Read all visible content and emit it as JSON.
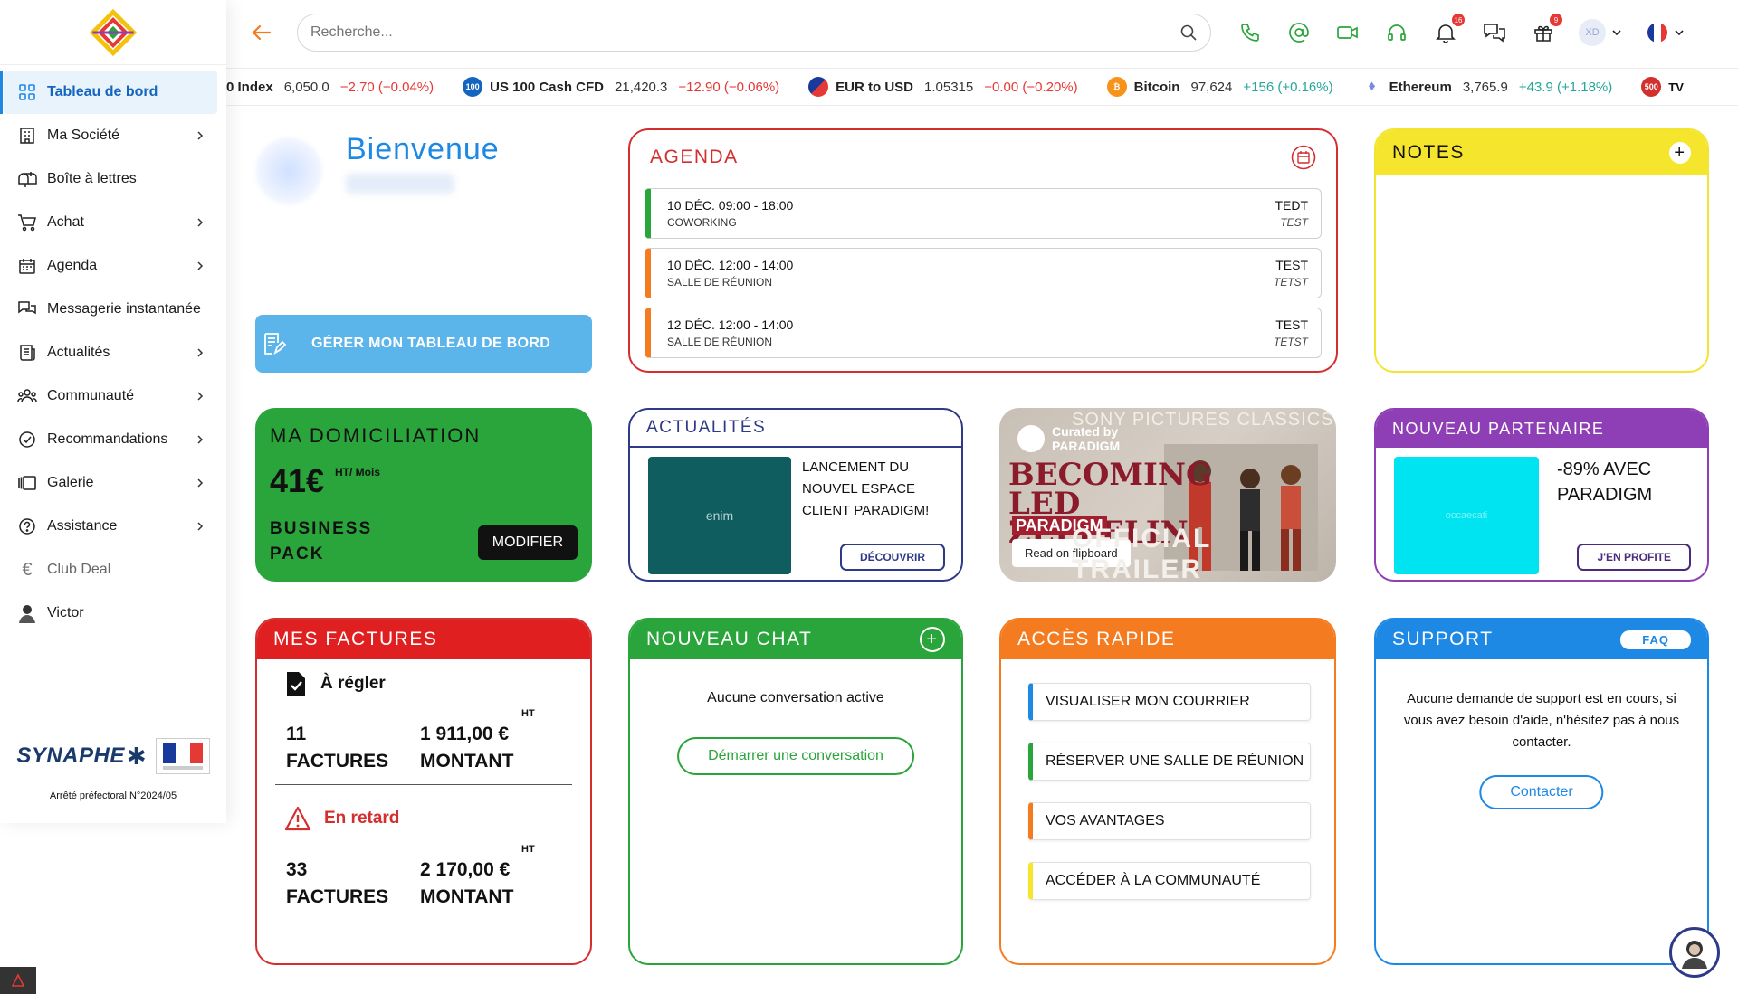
{
  "sidebar": {
    "items": [
      {
        "label": "Tableau de bord"
      },
      {
        "label": "Ma Société"
      },
      {
        "label": "Boîte à lettres"
      },
      {
        "label": "Achat"
      },
      {
        "label": "Agenda"
      },
      {
        "label": "Messagerie instantanée"
      },
      {
        "label": "Actualités"
      },
      {
        "label": "Communauté"
      },
      {
        "label": "Recommandations"
      },
      {
        "label": "Galerie"
      },
      {
        "label": "Assistance"
      },
      {
        "label": "Club Deal"
      },
      {
        "label": "Victor"
      }
    ],
    "footer": {
      "brand": "SYNAPHE",
      "arrete": "Arrêté préfectoral N°2024/05"
    }
  },
  "topbar": {
    "search_placeholder": "Recherche...",
    "notif_badge": "16",
    "gift_badge": "9",
    "avatar_initials": "XD"
  },
  "ticker": [
    {
      "name": "0 Index",
      "price": "6,050.0",
      "change": "−2.70 (−0.04%)",
      "dir": "neg"
    },
    {
      "icon": "100",
      "name": "US 100 Cash CFD",
      "price": "21,420.3",
      "change": "−12.90 (−0.06%)",
      "dir": "neg"
    },
    {
      "name": "EUR to USD",
      "price": "1.05315",
      "change": "−0.00 (−0.20%)",
      "dir": "neg"
    },
    {
      "name": "Bitcoin",
      "price": "97,624",
      "change": "+156 (+0.16%)",
      "dir": "pos"
    },
    {
      "name": "Ethereum",
      "price": "3,765.9",
      "change": "+43.9 (+1.18%)",
      "dir": "pos"
    },
    {
      "icon": "500",
      "name": "",
      "price": "",
      "change": "",
      "dir": "neg"
    }
  ],
  "welcome": {
    "title": "Bienvenue",
    "manage_label": "GÉRER MON TABLEAU DE BORD"
  },
  "agenda": {
    "title": "AGENDA",
    "events": [
      {
        "when": "10 DÉC. 09:00 - 18:00",
        "room": "COWORKING",
        "title": "TEDT",
        "sub": "TEST",
        "color": "#2aa53b"
      },
      {
        "when": "10 DÉC. 12:00 - 14:00",
        "room": "SALLE DE RÉUNION",
        "title": "TEST",
        "sub": "TETST",
        "color": "#f47b20"
      },
      {
        "when": "12 DÉC. 12:00 - 14:00",
        "room": "SALLE DE RÉUNION",
        "title": "TEST",
        "sub": "TETST",
        "color": "#f47b20"
      }
    ]
  },
  "notes": {
    "title": "NOTES"
  },
  "domiciliation": {
    "title": "MA DOMICILIATION",
    "price": "41€",
    "unit": "HT/ Mois",
    "pack": "BUSINESS PACK",
    "modify": "MODIFIER"
  },
  "actualites": {
    "title": "ACTUALITÉS",
    "image_alt": "enim",
    "text": "LANCEMENT DU NOUVEL ESPACE CLIENT PARADIGM!",
    "button": "DÉCOUVRIR"
  },
  "promo": {
    "studio": "SONY PICTURES CLASSICS",
    "curated": "Curated by",
    "curated_by": "PARADIGM",
    "title": "BECOMING LED ZEPPELIN",
    "subtitle": "PARADIGM",
    "read": "Read on flipboard",
    "trailer": "OFFICIAL TRAILER"
  },
  "partner": {
    "title": "NOUVEAU PARTENAIRE",
    "image_alt": "occaecati",
    "text": "-89% AVEC PARADIGM",
    "button": "J'EN PROFITE"
  },
  "invoices": {
    "title": "MES FACTURES",
    "due": {
      "label": "À régler",
      "count": "11",
      "count_label": "FACTURES",
      "ht": "HT",
      "amount": "1 911,00 €",
      "amount_label": "MONTANT"
    },
    "late": {
      "label": "En retard",
      "count": "33",
      "count_label": "FACTURES",
      "ht": "HT",
      "amount": "2 170,00 €",
      "amount_label": "MONTANT"
    }
  },
  "chat": {
    "title": "NOUVEAU CHAT",
    "empty": "Aucune conversation active",
    "start": "Démarrer une conversation"
  },
  "access": {
    "title": "ACCÈS RAPIDE",
    "items": [
      {
        "label": "VISUALISER MON COURRIER",
        "color": "#1e88e5"
      },
      {
        "label": "RÉSERVER UNE SALLE DE RÉUNION",
        "color": "#2aa53b"
      },
      {
        "label": "VOS AVANTAGES",
        "color": "#f47b20"
      },
      {
        "label": "ACCÉDER À LA COMMUNAUTÉ",
        "color": "#f5e52c"
      }
    ]
  },
  "support": {
    "title": "SUPPORT",
    "faq": "FAQ",
    "text": "Aucune demande de support est en cours, si vous avez besoin d'aide, n'hésitez pas à nous contacter.",
    "contact": "Contacter"
  },
  "colors": {
    "accent_blue": "#1e88e5",
    "red": "#e02020",
    "green": "#2aa53b",
    "orange": "#f47b20",
    "yellow": "#f5e52c",
    "purple": "#8e3fb5"
  }
}
